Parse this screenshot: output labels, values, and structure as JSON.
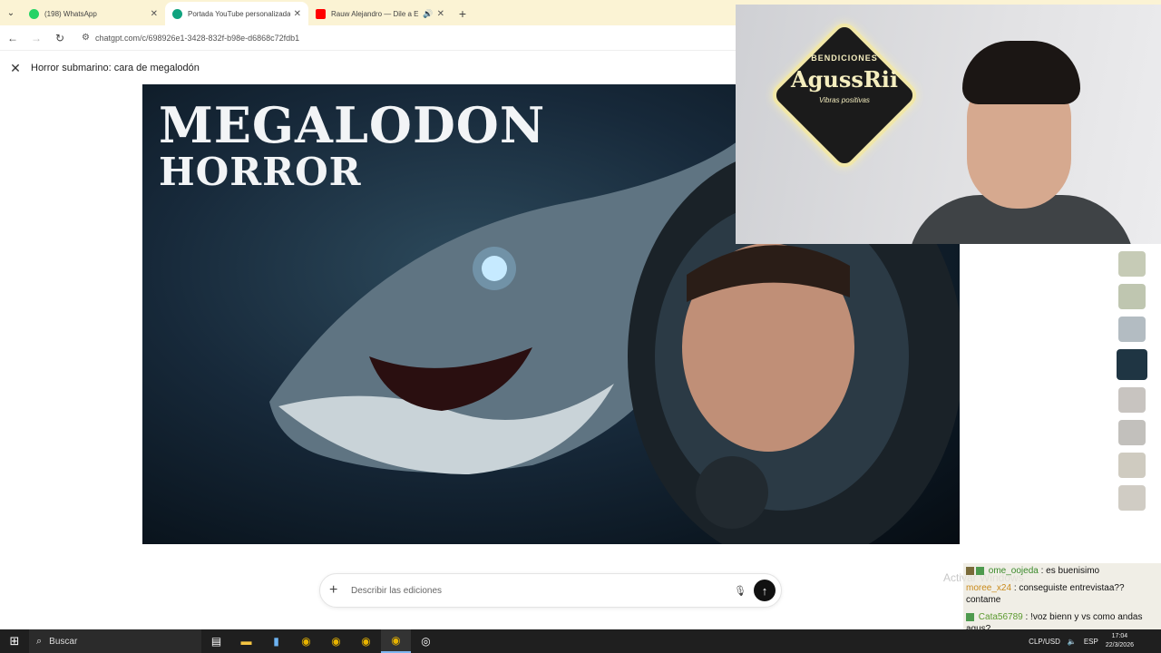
{
  "browser": {
    "tabs": [
      {
        "title": "(198) WhatsApp",
        "favicon_color": "#25d366",
        "active": false
      },
      {
        "title": "Portada YouTube personalizada",
        "favicon_color": "#10a37f",
        "active": true
      },
      {
        "title": "Rauw Alejandro — Dile a El",
        "favicon_color": "#ff0000",
        "active": false
      }
    ],
    "url": "chatgpt.com/c/698926e1-3428-832f-b98e-d6868c72fdb1"
  },
  "page": {
    "title": "Horror submarino: cara de megalodón",
    "image_text_line1": "Megalodon",
    "image_text_line2": "Horror",
    "composer_placeholder": "Describir las ediciones"
  },
  "watermark": "Activar Windows",
  "webcam": {
    "sign_top": "BENDICIONES",
    "sign_name": "AgussRii",
    "sign_bottom": "Vibras positivas"
  },
  "chat": [
    {
      "user": "ome_oojeda",
      "text": ": es buenisimo"
    },
    {
      "user": "moree_x24",
      "text": ": conseguiste entrevistaa?? contame"
    },
    {
      "user": "Cata56789",
      "text": ": !voz bienn y vs como andas agus?"
    }
  ],
  "taskbar": {
    "search_label": "Buscar",
    "currency": "CLP/USD",
    "language": "ESP",
    "time": "17:04",
    "date": "22/3/2026"
  },
  "colors": {
    "tabstrip": "#fbf3d4",
    "taskbar": "#1f1f1f",
    "send_button": "#111111"
  }
}
